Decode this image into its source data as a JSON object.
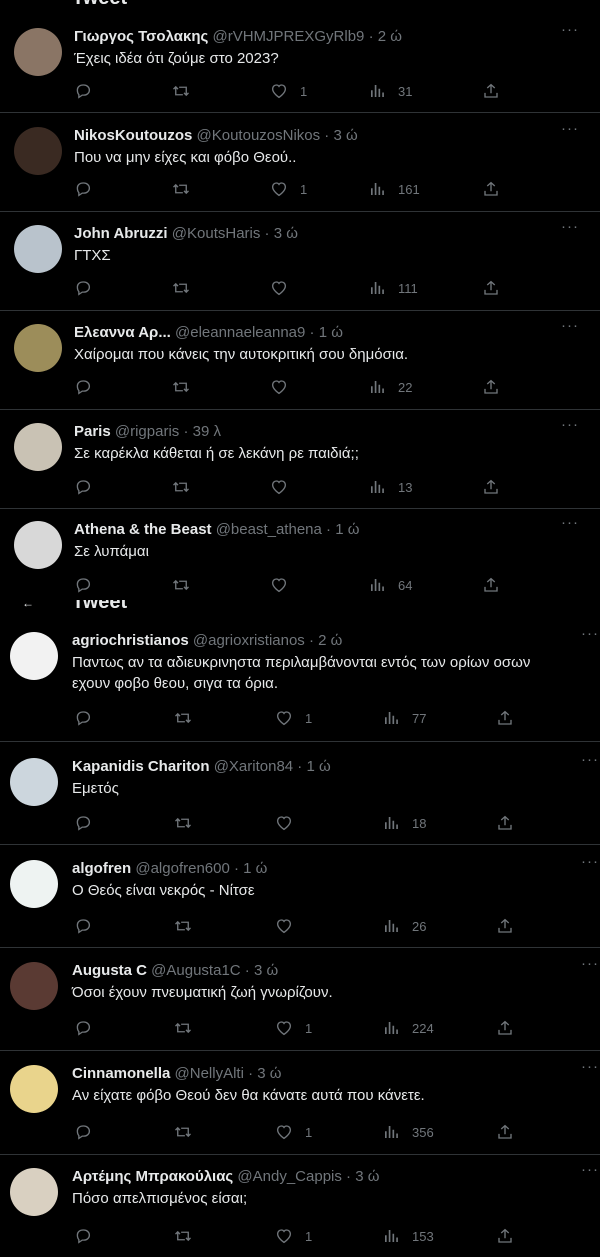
{
  "section_title": "Tweet",
  "panel_1_tweets": [
    {
      "name": "Γιωργος Τσολακης",
      "handle": "@rVHMJPREXGyRlb9",
      "time": "2 ώ",
      "text": "Έχεις ιδέα ότι ζούμε στο 2023?",
      "likes": "1",
      "views": "31",
      "avatar_color": "#8a7565"
    },
    {
      "name": "NikosKoutouzos",
      "handle": "@KoutouzosNikos",
      "time": "3 ώ",
      "text": "Που να μην είχες και φόβο Θεού..",
      "likes": "1",
      "views": "161",
      "avatar_color": "#3a2a22"
    },
    {
      "name": "John Abruzzi",
      "handle": "@KoutsHaris",
      "time": "3 ώ",
      "text": "ΓΤΧΣ",
      "likes": "",
      "views": "111",
      "avatar_color": "#b9c3cc"
    },
    {
      "name": "Ελεαννα Αρ...",
      "handle": "@eleannaeleanna9",
      "time": "1 ώ",
      "text": "Χαίρομαι που κάνεις την αυτοκριτική σου δημόσια.",
      "likes": "",
      "views": "22",
      "avatar_color": "#9c8d5a"
    },
    {
      "name": "Paris",
      "handle": "@rigparis",
      "time": "39 λ",
      "text": "Σε καρέκλα κάθεται ή σε λεκάνη ρε παιδιά;;",
      "likes": "",
      "views": "13",
      "avatar_color": "#c9c2b4"
    },
    {
      "name": "Athena & the Beast",
      "handle": "@beast_athena",
      "time": "1 ώ",
      "text": "Σε λυπάμαι",
      "likes": "",
      "views": "64",
      "avatar_color": "#d8d8d8"
    }
  ],
  "panel_2_tweets": [
    {
      "name": "agriochristianos",
      "handle": "@agrioxristianos",
      "time": "2 ώ",
      "text": "Παντως αν τα αδιευκρινηστα περιλαμβάνονται εντός των ορίων οσων",
      "text2": "εχουν φοβο θεου, σιγα τα όρια.",
      "likes": "1",
      "views": "77",
      "avatar_color": "#f2f2f2"
    },
    {
      "name": "Kapanidis Chariton",
      "handle": "@Xariton84",
      "time": "1 ώ",
      "text": "Εμετός",
      "likes": "",
      "views": "18",
      "avatar_color": "#ccd6dd"
    },
    {
      "name": "algofren",
      "handle": "@algofren600",
      "time": "1 ώ",
      "text": "Ο Θεός είναι νεκρός - Νίτσε",
      "likes": "",
      "views": "26",
      "avatar_color": "#eef3f2"
    },
    {
      "name": "Augusta C",
      "handle": "@Augusta1C",
      "time": "3 ώ",
      "text": "Όσοι έχουν πνευματική ζωή γνωρίζουν.",
      "likes": "1",
      "views": "224",
      "avatar_color": "#5a3a33"
    },
    {
      "name": "Cinnamonella",
      "handle": "@NellyAlti",
      "time": "3 ώ",
      "text": "Αν είχατε φόβο Θεού δεν θα κάνατε αυτά που κάνετε.",
      "likes": "1",
      "views": "356",
      "avatar_color": "#e9d48c"
    },
    {
      "name": "Αρτέμης Μπρακούλιας",
      "handle": "@Andy_Cappis",
      "time": "3 ώ",
      "text": "Πόσο απελπισμένος είσαι;",
      "likes": "1",
      "views": "153",
      "avatar_color": "#d9d0c1"
    }
  ],
  "icons": {
    "reply": "reply-icon",
    "retweet": "retweet-icon",
    "like": "heart-icon",
    "views": "views-bars-icon",
    "share": "share-icon",
    "more": "more-dots-icon"
  },
  "colors": {
    "background": "#000000",
    "text": "#e7e9ea",
    "secondary": "#71767b",
    "divider": "#2f3336"
  }
}
